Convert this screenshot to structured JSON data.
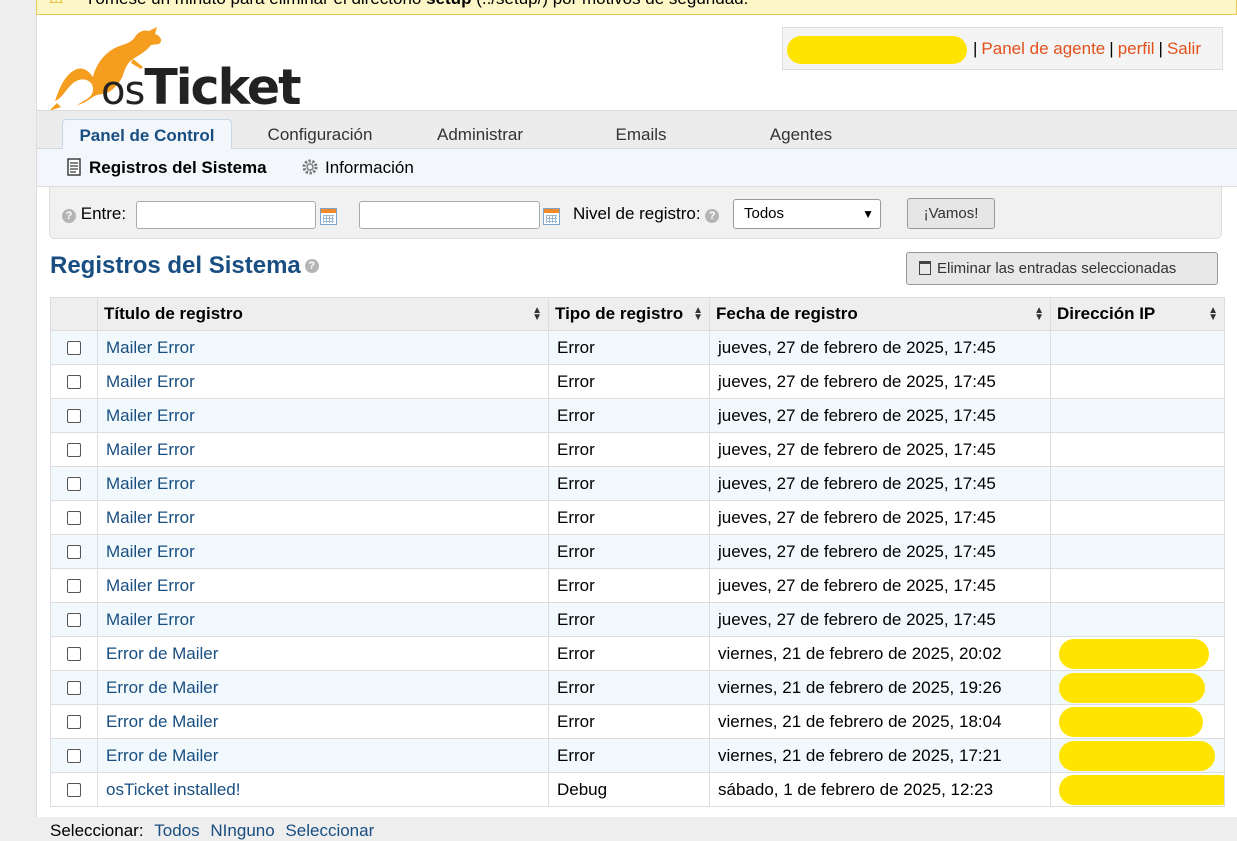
{
  "warning": {
    "prefix": "Tómese un minuto para eliminar el directorio",
    "dir": "setup",
    "suffix": "(../setup/) por motivos de seguridad."
  },
  "brand": {
    "logo_os": "os",
    "logo_ticket": "Ticket",
    "colors": {
      "accent": "#f49d1f",
      "link": "#184e81",
      "user_link": "#e2511c"
    }
  },
  "user_nav": {
    "agent_panel": "Panel de agente",
    "profile": "perfil",
    "logout": "Salir",
    "separator": "|"
  },
  "nav": {
    "tabs": [
      {
        "label": "Panel de Control",
        "active": true
      },
      {
        "label": "Configuración"
      },
      {
        "label": "Administrar"
      },
      {
        "label": "Emails"
      },
      {
        "label": "Agentes"
      }
    ]
  },
  "subnav": {
    "logs": "Registros del Sistema",
    "info": "Información"
  },
  "filter": {
    "between_label": "Entre:",
    "from_value": "",
    "to_value": "",
    "level_label": "Nivel de registro:",
    "level_selected": "Todos",
    "go_label": "¡Vamos!"
  },
  "page_title": "Registros del Sistema",
  "delete_selected": "Eliminar las entradas seleccionadas",
  "table": {
    "headers": [
      "Título de registro",
      "Tipo de registro",
      "Fecha de registro",
      "Dirección IP"
    ],
    "rows": [
      {
        "title": "Mailer Error",
        "type": "Error",
        "date": "jueves, 27 de febrero de 2025, 17:45",
        "ip": ""
      },
      {
        "title": "Mailer Error",
        "type": "Error",
        "date": "jueves, 27 de febrero de 2025, 17:45",
        "ip": ""
      },
      {
        "title": "Mailer Error",
        "type": "Error",
        "date": "jueves, 27 de febrero de 2025, 17:45",
        "ip": ""
      },
      {
        "title": "Mailer Error",
        "type": "Error",
        "date": "jueves, 27 de febrero de 2025, 17:45",
        "ip": ""
      },
      {
        "title": "Mailer Error",
        "type": "Error",
        "date": "jueves, 27 de febrero de 2025, 17:45",
        "ip": ""
      },
      {
        "title": "Mailer Error",
        "type": "Error",
        "date": "jueves, 27 de febrero de 2025, 17:45",
        "ip": ""
      },
      {
        "title": "Mailer Error",
        "type": "Error",
        "date": "jueves, 27 de febrero de 2025, 17:45",
        "ip": ""
      },
      {
        "title": "Mailer Error",
        "type": "Error",
        "date": "jueves, 27 de febrero de 2025, 17:45",
        "ip": ""
      },
      {
        "title": "Mailer Error",
        "type": "Error",
        "date": "jueves, 27 de febrero de 2025, 17:45",
        "ip": ""
      },
      {
        "title": "Error de Mailer",
        "type": "Error",
        "date": "viernes, 21 de febrero de 2025, 20:02",
        "ip": "redacted"
      },
      {
        "title": "Error de Mailer",
        "type": "Error",
        "date": "viernes, 21 de febrero de 2025, 19:26",
        "ip": "redacted"
      },
      {
        "title": "Error de Mailer",
        "type": "Error",
        "date": "viernes, 21 de febrero de 2025, 18:04",
        "ip": "redacted"
      },
      {
        "title": "Error de Mailer",
        "type": "Error",
        "date": "viernes, 21 de febrero de 2025, 17:21",
        "ip": "redacted"
      },
      {
        "title": "osTicket installed!",
        "type": "Debug",
        "date": "sábado, 1 de febrero de 2025, 12:23",
        "ip": "redacted"
      }
    ]
  },
  "footer": {
    "select_label": "Seleccionar:",
    "all": "Todos",
    "none": "NInguno",
    "toggle": "Seleccionar"
  }
}
